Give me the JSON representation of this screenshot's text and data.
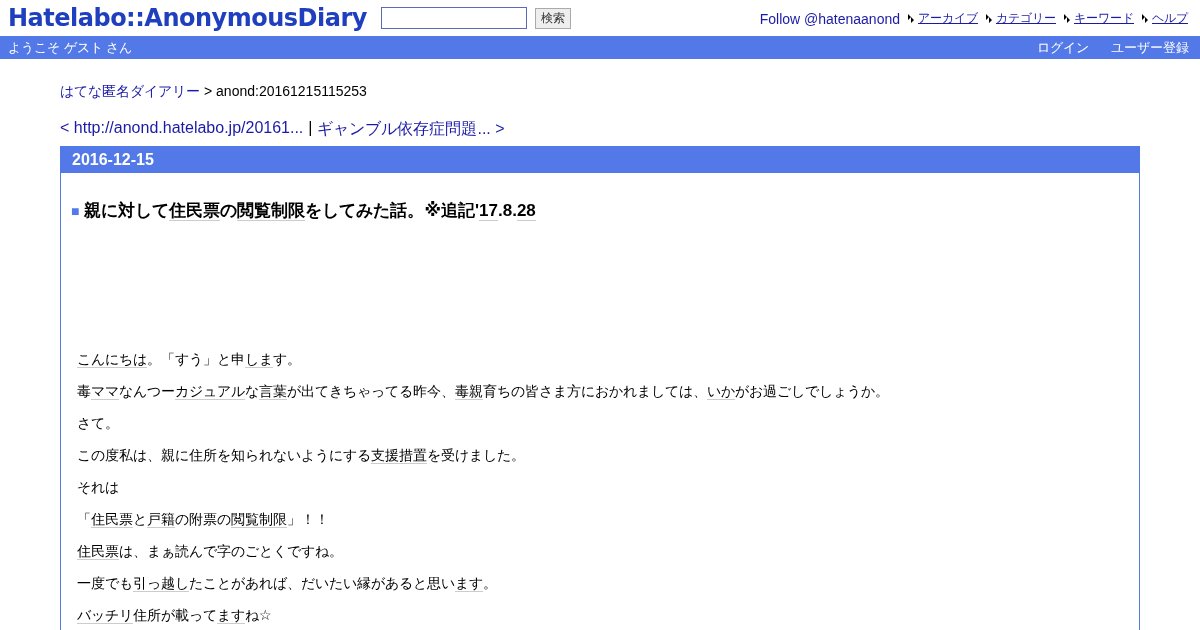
{
  "header": {
    "logo": "Hatelabo::AnonymousDiary",
    "search": {
      "button": "検索"
    },
    "follow": "Follow @hatenaanond",
    "nav": [
      "アーカイブ",
      "カテゴリー",
      "キーワード",
      "ヘルプ"
    ]
  },
  "welcome_bar": {
    "greeting": "ようこそ ゲスト さん",
    "links": [
      "ログイン",
      "ユーザー登録"
    ]
  },
  "breadcrumb": {
    "link": "はてな匿名ダイアリー",
    "current": "> anond:20161215115253"
  },
  "pager": {
    "prev": "< http://anond.hatelabo.jp/20161...",
    "separator": "|",
    "next": "ギャンブル依存症問題... >"
  },
  "day": {
    "date": "2016-12-15",
    "marker": "■",
    "title": [
      {
        "text": "親に対して",
        "keyword": false
      },
      {
        "text": "住民票",
        "keyword": true
      },
      {
        "text": "の",
        "keyword": false
      },
      {
        "text": "閲覧制限",
        "keyword": true
      },
      {
        "text": "をしてみた話。※追記'",
        "keyword": false
      },
      {
        "text": "17",
        "keyword": true
      },
      {
        "text": ".8.",
        "keyword": false
      },
      {
        "text": "28",
        "keyword": true
      }
    ],
    "paragraphs": [
      [
        {
          "text": "こんにちは",
          "keyword": true
        },
        {
          "text": "。「すう」と申",
          "keyword": false
        },
        {
          "text": "しま",
          "keyword": true
        },
        {
          "text": "す。",
          "keyword": false
        }
      ],
      [
        {
          "text": "毒",
          "keyword": false
        },
        {
          "text": "ママ",
          "keyword": true
        },
        {
          "text": "なんつー",
          "keyword": false
        },
        {
          "text": "カジュアル",
          "keyword": true
        },
        {
          "text": "な",
          "keyword": false
        },
        {
          "text": "言葉",
          "keyword": true
        },
        {
          "text": "が出てきちゃってる昨今、",
          "keyword": false
        },
        {
          "text": "毒親",
          "keyword": true
        },
        {
          "text": "育ちの皆さま方におかれましては、",
          "keyword": false
        },
        {
          "text": "いか",
          "keyword": true
        },
        {
          "text": "がお過ごしでしょうか。",
          "keyword": false
        }
      ],
      [
        {
          "text": "さて。",
          "keyword": false
        }
      ],
      [
        {
          "text": "この度私は、親に住所を知られないようにする",
          "keyword": false
        },
        {
          "text": "支援措置",
          "keyword": true
        },
        {
          "text": "を受けました。",
          "keyword": false
        }
      ],
      [
        {
          "text": "それは",
          "keyword": false
        }
      ],
      [
        {
          "text": "「",
          "keyword": false
        },
        {
          "text": "住民票",
          "keyword": true
        },
        {
          "text": "と",
          "keyword": false
        },
        {
          "text": "戸籍",
          "keyword": true
        },
        {
          "text": "の附票の",
          "keyword": false
        },
        {
          "text": "閲覧制限",
          "keyword": true
        },
        {
          "text": "」！！",
          "keyword": false
        }
      ],
      [
        {
          "text": "住民票",
          "keyword": true
        },
        {
          "text": "は、まぁ読んで字のごとくですね。",
          "keyword": false
        }
      ],
      [
        {
          "text": "一度でも",
          "keyword": false
        },
        {
          "text": "引っ越し",
          "keyword": true
        },
        {
          "text": "たことがあれば、だいたい縁があると思い",
          "keyword": false
        },
        {
          "text": "ます",
          "keyword": true
        },
        {
          "text": "。",
          "keyword": false
        }
      ],
      [
        {
          "text": "バッチリ",
          "keyword": true
        },
        {
          "text": "住所が載って",
          "keyword": false
        },
        {
          "text": "ます",
          "keyword": true
        },
        {
          "text": "ね☆",
          "keyword": false
        }
      ]
    ]
  }
}
